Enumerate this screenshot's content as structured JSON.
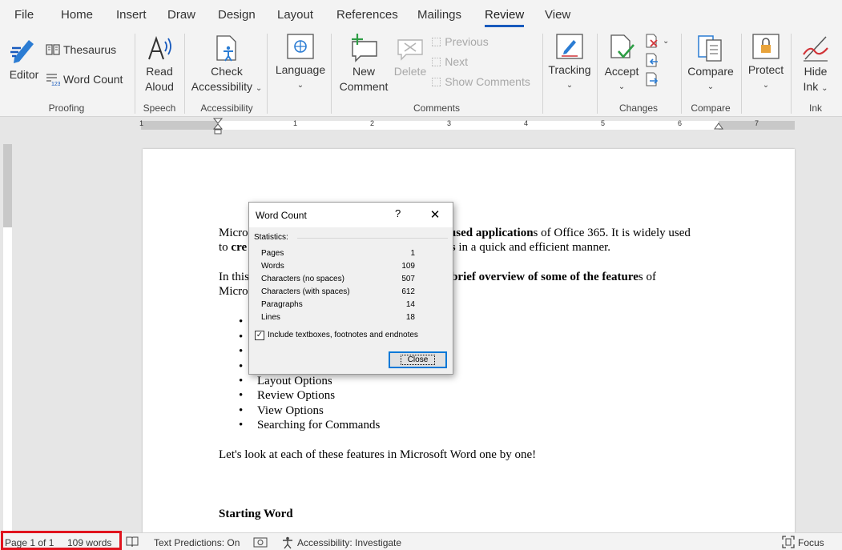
{
  "tabs": [
    "File",
    "Home",
    "Insert",
    "Draw",
    "Design",
    "Layout",
    "References",
    "Mailings",
    "Review",
    "View"
  ],
  "active_tab": "Review",
  "ribbon": {
    "editor": "Editor",
    "thesaurus": "Thesaurus",
    "word_count": "Word Count",
    "proofing": "Proofing",
    "read_aloud_1": "Read",
    "read_aloud_2": "Aloud",
    "speech": "Speech",
    "check_acc_1": "Check",
    "check_acc_2": "Accessibility",
    "accessibility": "Accessibility",
    "language": "Language",
    "new_comment_1": "New",
    "new_comment_2": "Comment",
    "delete": "Delete",
    "previous": "Previous",
    "next": "Next",
    "show_comments": "Show Comments",
    "comments": "Comments",
    "tracking": "Tracking",
    "accept": "Accept",
    "changes": "Changes",
    "compare_btn": "Compare",
    "compare_grp": "Compare",
    "protect": "Protect",
    "hide_ink_1": "Hide",
    "hide_ink_2": "Ink",
    "ink": "Ink"
  },
  "ruler_numbers": [
    "1",
    "1",
    "2",
    "3",
    "4",
    "5",
    "6",
    "7"
  ],
  "document": {
    "p1_line1_a": "Micro",
    "p1_line1_b": "y used application",
    "p1_line1_c": "s of Office 365. It is widely used",
    "p1_line2_a": "to ",
    "p1_line2_b": "cre",
    "p1_line2_c": "hers",
    "p1_line2_d": " in a quick and efficient manner.",
    "p2_line1_a": "In this",
    "p2_line1_b": " a ",
    "p2_line1_c": "brief overview of some of the feature",
    "p2_line1_d": "s of",
    "p2_line2": "Micro",
    "bullets": [
      "Layout Options",
      "Review Options",
      "View Options",
      "Searching for Commands"
    ],
    "closing": "Let's look at each of these features in Microsoft Word one by one!",
    "heading": "Starting Word"
  },
  "dialog": {
    "title": "Word Count",
    "help": "?",
    "statistics_label": "Statistics:",
    "stats": [
      {
        "name": "Pages",
        "value": "1"
      },
      {
        "name": "Words",
        "value": "109"
      },
      {
        "name": "Characters (no spaces)",
        "value": "507"
      },
      {
        "name": "Characters (with spaces)",
        "value": "612"
      },
      {
        "name": "Paragraphs",
        "value": "14"
      },
      {
        "name": "Lines",
        "value": "18"
      }
    ],
    "include_label": "Include textboxes, footnotes and endnotes",
    "include_checked": true,
    "close_label": "Close"
  },
  "status": {
    "page": "Page 1 of 1",
    "words": "109 words",
    "text_predictions": "Text Predictions: On",
    "accessibility": "Accessibility: Investigate",
    "focus": "Focus"
  },
  "colors": {
    "accent": "#185abd",
    "highlight_box": "#e0141e"
  }
}
